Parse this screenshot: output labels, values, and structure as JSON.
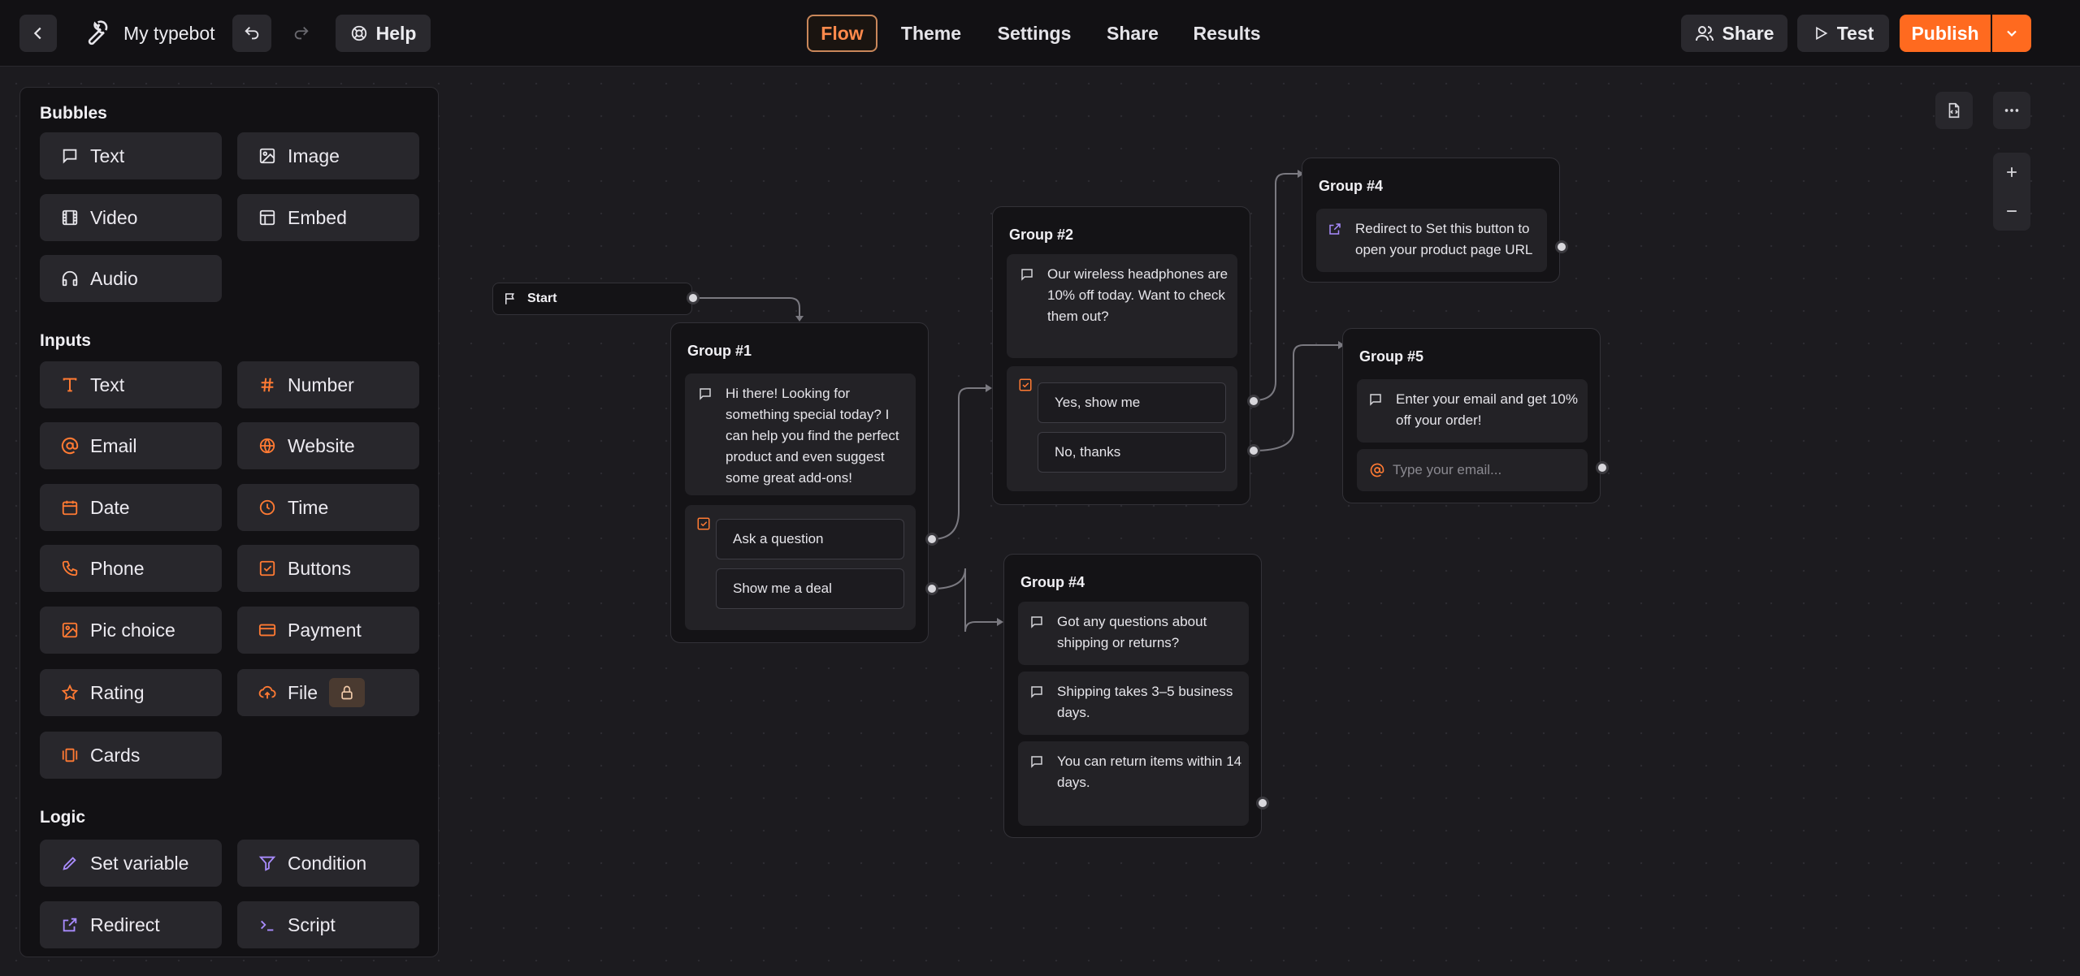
{
  "topbar": {
    "typebot_name": "My typebot",
    "help_label": "Help",
    "tabs": [
      "Flow",
      "Theme",
      "Settings",
      "Share",
      "Results"
    ],
    "share_label": "Share",
    "test_label": "Test",
    "publish_label": "Publish"
  },
  "sidebar": {
    "bubbles_title": "Bubbles",
    "bubbles": [
      "Text",
      "Image",
      "Video",
      "Embed",
      "Audio"
    ],
    "inputs_title": "Inputs",
    "inputs": [
      "Text",
      "Number",
      "Email",
      "Website",
      "Date",
      "Time",
      "Phone",
      "Buttons",
      "Pic choice",
      "Payment",
      "Rating",
      "File",
      "Cards"
    ],
    "logic_title": "Logic",
    "logic": [
      "Set variable",
      "Condition",
      "Redirect",
      "Script"
    ]
  },
  "canvas": {
    "start_label": "Start",
    "group1": {
      "title": "Group #1",
      "message": "Hi there! Looking for something special today? I can help you find the perfect product and even suggest some great add-ons!",
      "choices": [
        "Ask a question",
        "Show me a deal"
      ]
    },
    "group2": {
      "title": "Group #2",
      "message": "Our wireless headphones are 10% off today. Want to check them out?",
      "choices": [
        "Yes, show me",
        "No, thanks"
      ]
    },
    "group4_top": {
      "title": "Group #4",
      "message": "Redirect to Set this button to open your product page URL"
    },
    "group5": {
      "title": "Group #5",
      "message": "Enter your email and get 10% off your order!",
      "email_placeholder": "Type your email..."
    },
    "group4_bottom": {
      "title": "Group #4",
      "messages": [
        "Got any questions about shipping or returns?",
        "Shipping takes 3–5 business days.",
        "You can return items within 14 days."
      ]
    }
  },
  "colors": {
    "accent": "#ff6a1f",
    "canvas": "#1c1b1f",
    "panel": "#121114",
    "block": "#28272c"
  }
}
